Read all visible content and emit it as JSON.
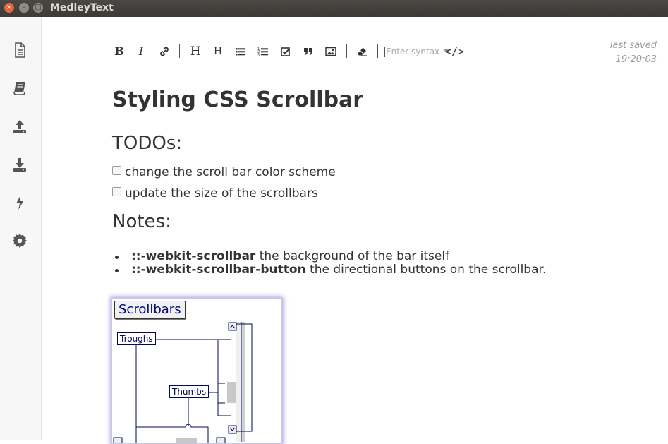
{
  "window": {
    "title": "MedleyText",
    "controls": {
      "close": "×",
      "minimize": "–",
      "maximize": "□"
    }
  },
  "sidebar": {
    "items": [
      {
        "icon": "file-icon"
      },
      {
        "icon": "book-icon"
      },
      {
        "icon": "upload-icon"
      },
      {
        "icon": "download-icon"
      },
      {
        "icon": "bolt-icon"
      },
      {
        "icon": "gear-icon"
      }
    ]
  },
  "toolbar": {
    "bold": "B",
    "italic": "I",
    "heading_large": "H",
    "heading_small": "H",
    "syntax_placeholder": "Enter syntax",
    "code": "</>"
  },
  "status": {
    "saved_label": "last saved",
    "saved_time": "19:20:03"
  },
  "document": {
    "title": "Styling CSS Scrollbar",
    "todos_heading": "TODOs:",
    "todos": [
      {
        "text": "change the scroll bar color scheme",
        "checked": false
      },
      {
        "text": "update the size of the scrollbars",
        "checked": false
      }
    ],
    "notes_heading": "Notes:",
    "notes": [
      {
        "term": "::-webkit-scrollbar",
        "desc": " the background of the bar itself"
      },
      {
        "term": "::-webkit-scrollbar-button",
        "desc": " the directional buttons on the scrollbar."
      }
    ]
  },
  "figure": {
    "title": "Scrollbars",
    "labels": {
      "troughs": "Troughs",
      "thumbs": "Thumbs"
    },
    "colors": {
      "line": "#00075a",
      "glow": "#6e64c8"
    }
  }
}
